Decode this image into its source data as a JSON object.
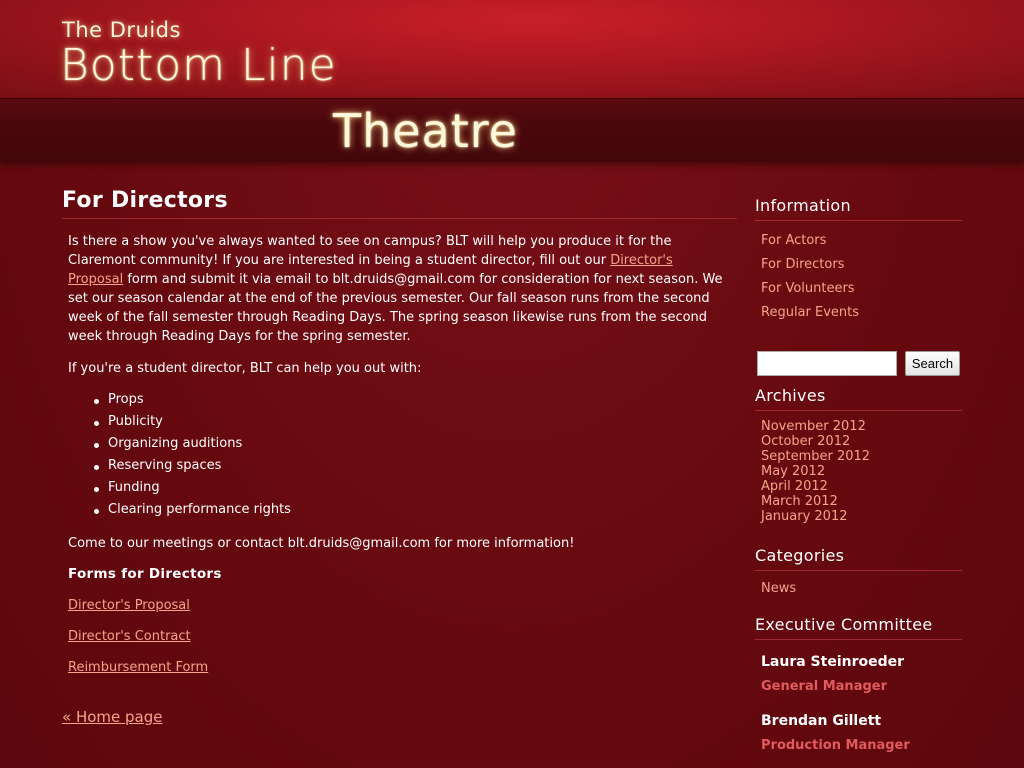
{
  "header": {
    "small_title": "The Druids",
    "title": "Bottom Line",
    "subtitle": "Theatre"
  },
  "main": {
    "title": "For Directors",
    "intro_before_link": "Is there a show you've always wanted to see on campus? BLT will help you produce it for the Claremont community! If you are interested in being a student director, fill out our ",
    "intro_link": "Director's Proposal",
    "intro_after_link": " form and submit it via email to blt.druids@gmail.com for consideration for next season. We set our season calendar at the end of the previous semester. Our fall season runs from the second week of the fall semester through Reading Days. The spring season likewise runs from the second week through Reading Days for the spring semester.",
    "help_intro": "If you're a student director, BLT can help you out with:",
    "help_items": [
      "Props",
      "Publicity",
      "Organizing auditions",
      "Reserving spaces",
      "Funding",
      "Clearing performance rights"
    ],
    "contact": "Come to our meetings or contact blt.druids@gmail.com for more information!",
    "forms_heading": "Forms for Directors",
    "forms": [
      "Director's Proposal",
      "Director's Contract",
      "Reimbursement Form"
    ],
    "home_link": "« Home page"
  },
  "sidebar": {
    "information": {
      "heading": "Information",
      "items": [
        "For Actors",
        "For Directors",
        "For Volunteers",
        "Regular Events"
      ]
    },
    "search": {
      "value": "",
      "button": "Search"
    },
    "archives": {
      "heading": "Archives",
      "items": [
        "November 2012",
        "October 2012",
        "September 2012",
        "May 2012",
        "April 2012",
        "March 2012",
        "January 2012"
      ]
    },
    "categories": {
      "heading": "Categories",
      "items": [
        "News"
      ]
    },
    "committee": {
      "heading": "Executive Committee",
      "members": [
        {
          "name": "Laura Steinroeder",
          "role": "General Manager"
        },
        {
          "name": "Brendan Gillett",
          "role": "Production Manager"
        }
      ]
    }
  }
}
